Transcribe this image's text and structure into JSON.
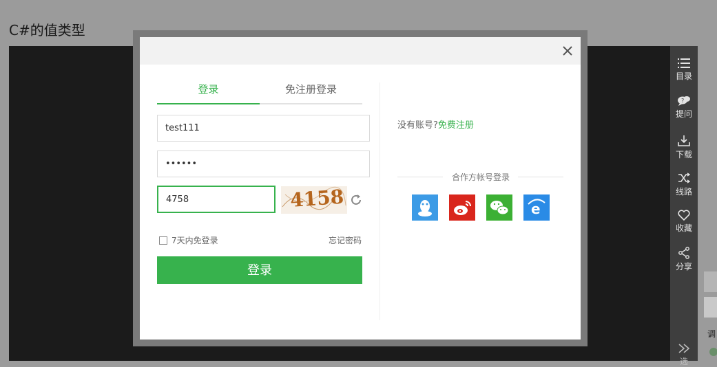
{
  "page": {
    "title": "C#的值类型"
  },
  "sidebar": {
    "items": [
      {
        "label": "目录",
        "icon": "list-icon"
      },
      {
        "label": "提问",
        "icon": "question-bubble-icon"
      },
      {
        "label": "下载",
        "icon": "download-icon"
      },
      {
        "label": "线路",
        "icon": "shuffle-icon"
      },
      {
        "label": "收藏",
        "icon": "heart-icon"
      },
      {
        "label": "分享",
        "icon": "share-icon"
      }
    ],
    "bottom_icon": "next-icon",
    "bottom_label": "选"
  },
  "right_edge": {
    "partial_text": "调"
  },
  "login_dialog": {
    "tabs": [
      {
        "label": "登录",
        "active": true
      },
      {
        "label": "免注册登录",
        "active": false
      }
    ],
    "username_value": "test111",
    "password_value": "••••••",
    "captcha_value": "4758",
    "captcha_image_text": "4158",
    "remember_label": "7天内免登录",
    "forgot_label": "忘记密码",
    "submit_label": "登录",
    "no_account_text": "没有账号?",
    "register_label": "免费注册",
    "partner_title": "合作方帐号登录",
    "partners": [
      {
        "name": "qq",
        "icon": "qq-icon",
        "color": "#3c9be6"
      },
      {
        "name": "weibo",
        "icon": "weibo-icon",
        "color": "#d9261c"
      },
      {
        "name": "wechat",
        "icon": "wechat-icon",
        "color": "#3cb034"
      },
      {
        "name": "ie",
        "icon": "ie-icon",
        "color": "#2a8be6"
      }
    ]
  },
  "colors": {
    "accent": "#37b24d",
    "overlay": "#9b9b9b",
    "sidebar_bg": "#3e3e3e"
  }
}
